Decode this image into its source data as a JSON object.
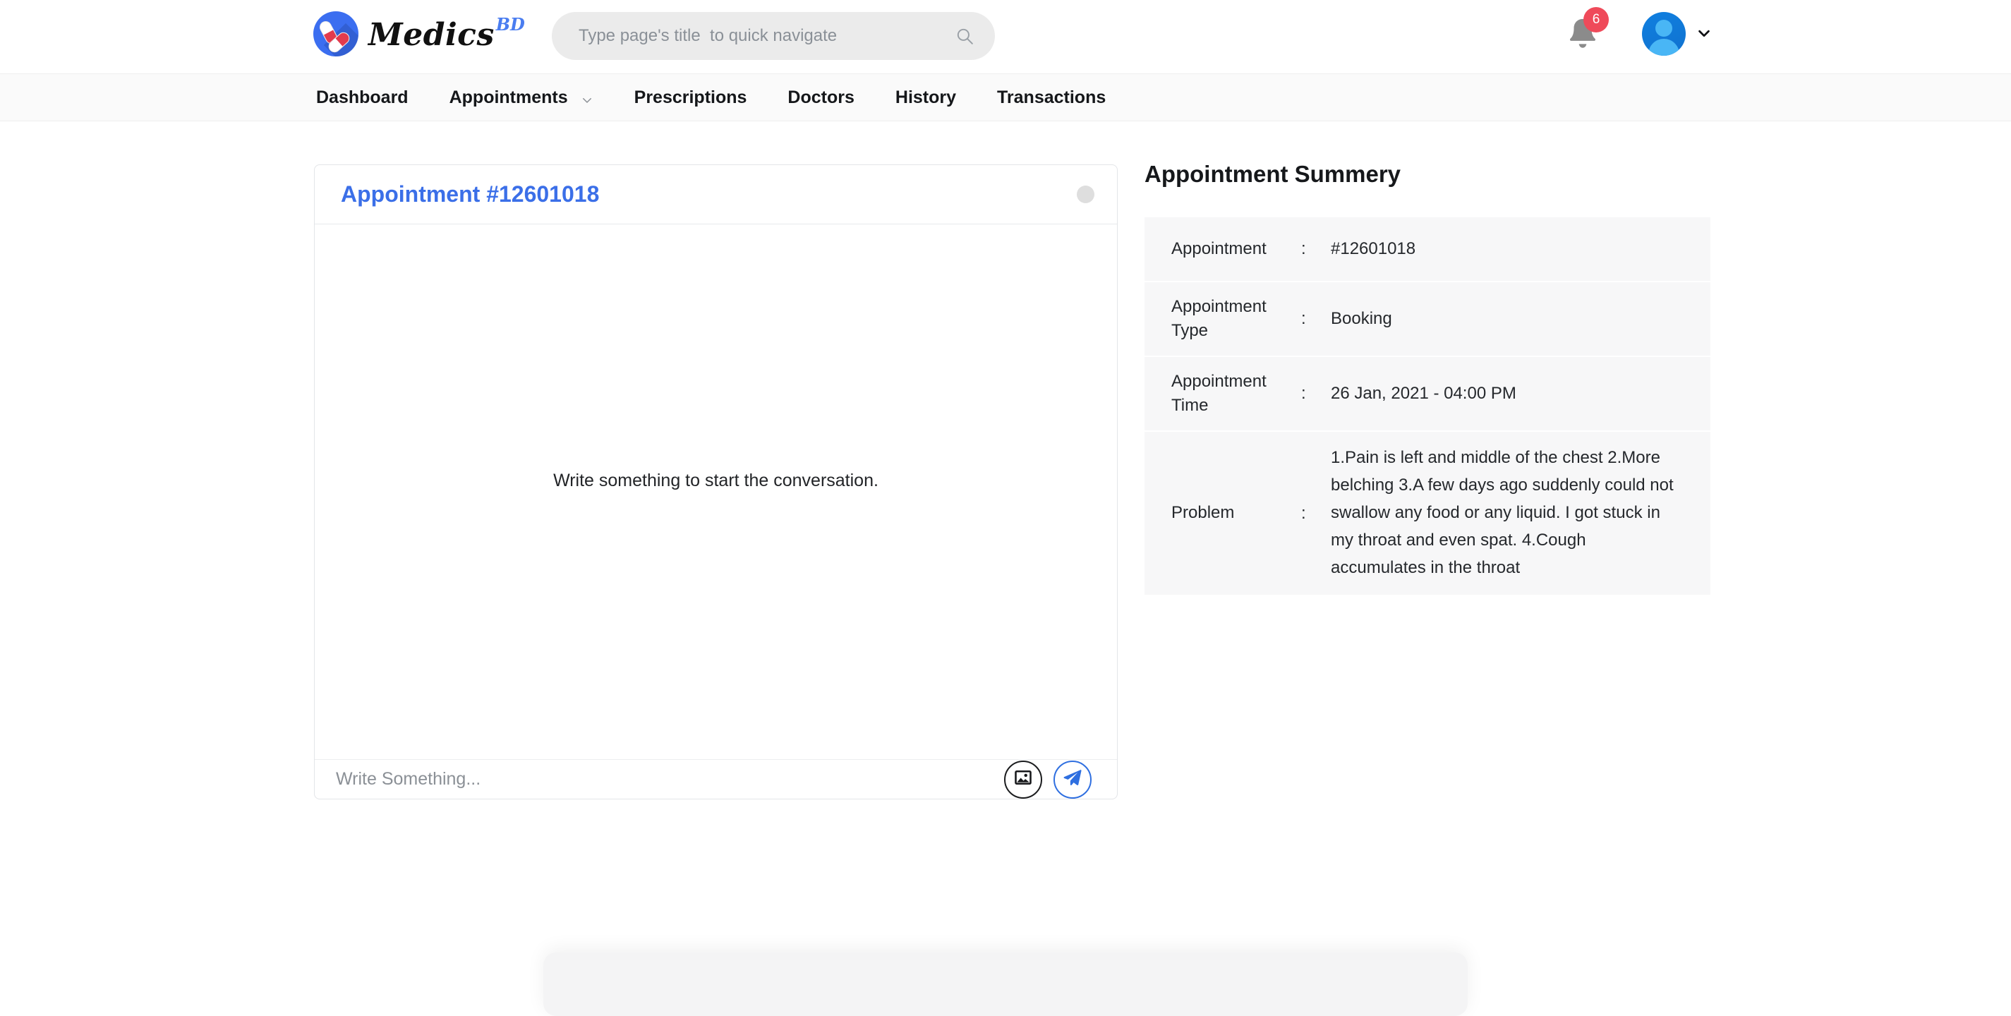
{
  "header": {
    "brand_name": "Medics",
    "brand_suffix": "BD",
    "brand_icon": "pills-logo-icon",
    "search": {
      "placeholder": "Type page's title  to quick navigate",
      "value": "",
      "icon": "search-icon"
    },
    "notifications": {
      "icon": "bell-icon",
      "count": "6",
      "badge_color": "#ef4a5a"
    },
    "account": {
      "avatar_icon": "user-avatar-icon",
      "caret_icon": "chevron-down-icon"
    }
  },
  "navbar": {
    "items": [
      {
        "label": "Dashboard",
        "has_caret": false
      },
      {
        "label": "Appointments",
        "has_caret": true
      },
      {
        "label": "Prescriptions",
        "has_caret": false
      },
      {
        "label": "Doctors",
        "has_caret": false
      },
      {
        "label": "History",
        "has_caret": false
      },
      {
        "label": "Transactions",
        "has_caret": false
      }
    ]
  },
  "chat": {
    "title": "Appointment #12601018",
    "title_color": "#3b6fe8",
    "status_dot_color": "#dedede",
    "empty_message": "Write something to start the conversation.",
    "input": {
      "placeholder": "Write Something...",
      "value": ""
    },
    "attach_icon": "image-icon",
    "send_icon": "send-paper-plane-icon"
  },
  "summary": {
    "title": "Appointment Summery",
    "separator": ":",
    "rows": [
      {
        "label": "Appointment",
        "value": "#12601018"
      },
      {
        "label": "Appointment Type",
        "value": "Booking"
      },
      {
        "label": "Appointment Time",
        "value": "26 Jan, 2021 - 04:00 PM"
      },
      {
        "label": "Problem",
        "value": "1.Pain is left and middle of the chest 2.More belching 3.A few days ago suddenly could not swallow any food or any liquid. I got stuck in my throat and even spat. 4.Cough accumulates in the throat"
      }
    ]
  }
}
